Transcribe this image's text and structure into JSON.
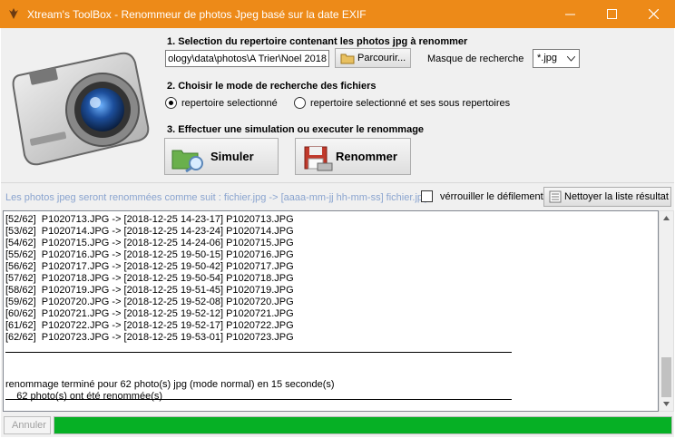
{
  "window": {
    "title": "Xtream's ToolBox - Renommeur de photos Jpeg basé sur la date EXIF",
    "title_color": "#ed8a18"
  },
  "step1": {
    "heading": "1. Selection du repertoire contenant les photos jpg à renommer",
    "path_value": "ology\\data\\photos\\A Trier\\Noel 2018",
    "browse_label": "Parcourir...",
    "mask_label": "Masque de recherche",
    "mask_value": "*.jpg"
  },
  "step2": {
    "heading": "2. Choisir le mode de recherche des fichiers",
    "option1": "repertoire selectionné",
    "option2": "repertoire selectionné et ses sous repertoires",
    "selected": 1
  },
  "step3": {
    "heading": "3. Effectuer une simulation ou executer le renommage",
    "simulate_label": "Simuler",
    "rename_label": "Renommer"
  },
  "options": {
    "hint": "Les photos jpeg seront renommées comme suit : fichier.jpg -> [aaaa-mm-jj hh-mm-ss] fichier.jpg",
    "lock_scroll_label": "vérrouiller le défilement",
    "lock_scroll_checked": false,
    "clear_label": "Nettoyer la liste résultat"
  },
  "log": {
    "lines": [
      "[52/62]  P1020713.JPG -> [2018-12-25 14-23-17] P1020713.JPG",
      "[53/62]  P1020714.JPG -> [2018-12-25 14-23-24] P1020714.JPG",
      "[54/62]  P1020715.JPG -> [2018-12-25 14-24-06] P1020715.JPG",
      "[55/62]  P1020716.JPG -> [2018-12-25 19-50-15] P1020716.JPG",
      "[56/62]  P1020717.JPG -> [2018-12-25 19-50-42] P1020717.JPG",
      "[57/62]  P1020718.JPG -> [2018-12-25 19-50-54] P1020718.JPG",
      "[58/62]  P1020719.JPG -> [2018-12-25 19-51-45] P1020719.JPG",
      "[59/62]  P1020720.JPG -> [2018-12-25 19-52-08] P1020720.JPG",
      "[60/62]  P1020721.JPG -> [2018-12-25 19-52-12] P1020721.JPG",
      "[61/62]  P1020722.JPG -> [2018-12-25 19-52-17] P1020722.JPG",
      "[62/62]  P1020723.JPG -> [2018-12-25 19-53-01] P1020723.JPG",
      "",
      "",
      "",
      "renommage terminé pour 62 photo(s) jpg (mode normal) en 15 seconde(s)",
      "    62 photo(s) ont été renommée(s)"
    ]
  },
  "footer": {
    "cancel_label": "Annuler",
    "progress_fraction": 1.0,
    "progress_color": "#06b025"
  }
}
